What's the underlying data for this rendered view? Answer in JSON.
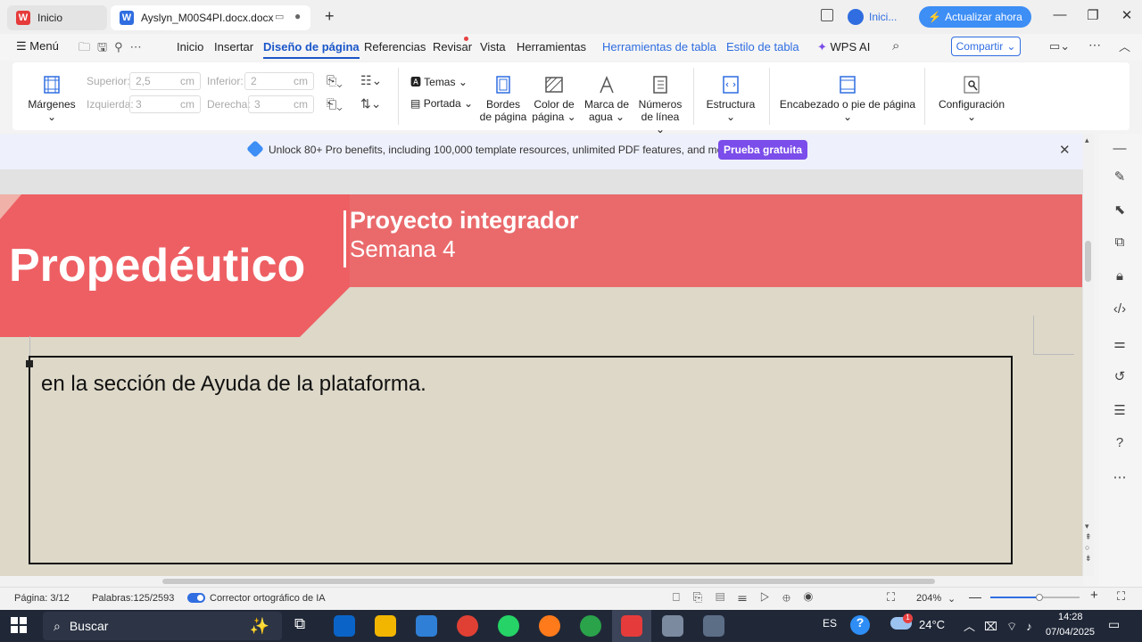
{
  "tabs": {
    "home": "Inicio",
    "doc": "Ayslyn_M00S4PI.docx.docx"
  },
  "titlebar": {
    "user": "Inici...",
    "upgrade": "Actualizar ahora"
  },
  "menubar": {
    "menu": "Menú",
    "items": [
      "Inicio",
      "Insertar",
      "Diseño de página",
      "Referencias",
      "Revisar",
      "Vista",
      "Herramientas",
      "Herramientas de tabla",
      "Estilo de tabla",
      "WPS AI"
    ],
    "share": "Compartir"
  },
  "ribbon": {
    "margins": "Márgenes",
    "top_label": "Superior:",
    "top_value": "2,5",
    "bottom_label": "Inferior:",
    "bottom_value": "2",
    "left_label": "Izquierda:",
    "left_value": "3",
    "right_label": "Derecha:",
    "right_value": "3",
    "unit": "cm",
    "themes": "Temas",
    "cover": "Portada",
    "page_borders_1": "Bordes",
    "page_borders_2": "de página",
    "page_color_1": "Color de",
    "page_color_2": "página",
    "watermark_1": "Marca de",
    "watermark_2": "agua",
    "line_numbers_1": "Números",
    "line_numbers_2": "de línea",
    "structure": "Estructura",
    "header_footer": "Encabezado o pie de página",
    "settings": "Configuración"
  },
  "banner": {
    "text": "Unlock 80+ Pro benefits, including 100,000 template resources, unlimited PDF features, and more.",
    "trial": "Prueba gratuita"
  },
  "document": {
    "header_title": "Propedéutico",
    "header_right_1": "Proyecto integrador",
    "header_right_2": "Semana 4",
    "body_text": "en la sección de Ayuda de la plataforma."
  },
  "status": {
    "page": "Página: 3/12",
    "words": "Palabras:125/2593",
    "spell": "Corrector ortográfico de IA",
    "zoom": "204%",
    "zoom_fraction": 0.55
  },
  "taskbar": {
    "search": "Buscar",
    "lang": "ES",
    "temp": "24°C",
    "time": "14:28",
    "date": "07/04/2025",
    "weather_badge": "1"
  },
  "colors": {
    "accent": "#1a56c9",
    "header_band": "#ea6a6c",
    "page_bg": "#ddd8c8",
    "trial": "#7b4dea",
    "upgrade": "#3d8ef5"
  }
}
